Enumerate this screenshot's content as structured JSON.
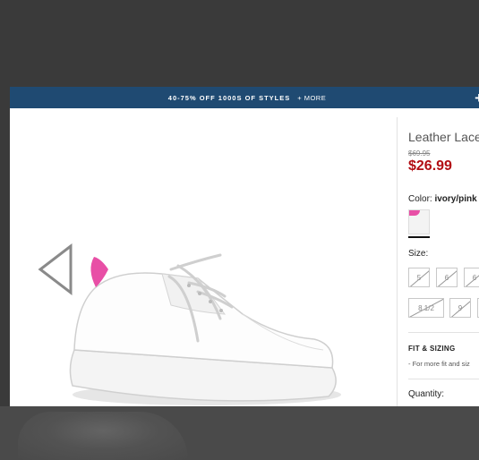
{
  "promo": {
    "main_text": "40-75% OFF 1000S OF STYLES",
    "more_text": "+ MORE",
    "close_glyph": "+"
  },
  "product": {
    "title": "Leather Lace",
    "original_price": "$69.95",
    "sale_price": "$26.99",
    "color_label": "Color: ",
    "color_value": "ivory/pink",
    "size_label": "Size:",
    "sizes": [
      "5",
      "6",
      "6",
      "8 1/2",
      "9"
    ],
    "fit_title": "FIT & SIZING",
    "fit_text": "- For more fit and siz",
    "quantity_label": "Quantity:"
  },
  "colors": {
    "promo_bar": "#1f4a72",
    "sale_price": "#b20e14",
    "accent_pink": "#e84fa6"
  },
  "icons": {
    "prev": "triangle-left-outline-icon",
    "close": "plus-icon"
  }
}
